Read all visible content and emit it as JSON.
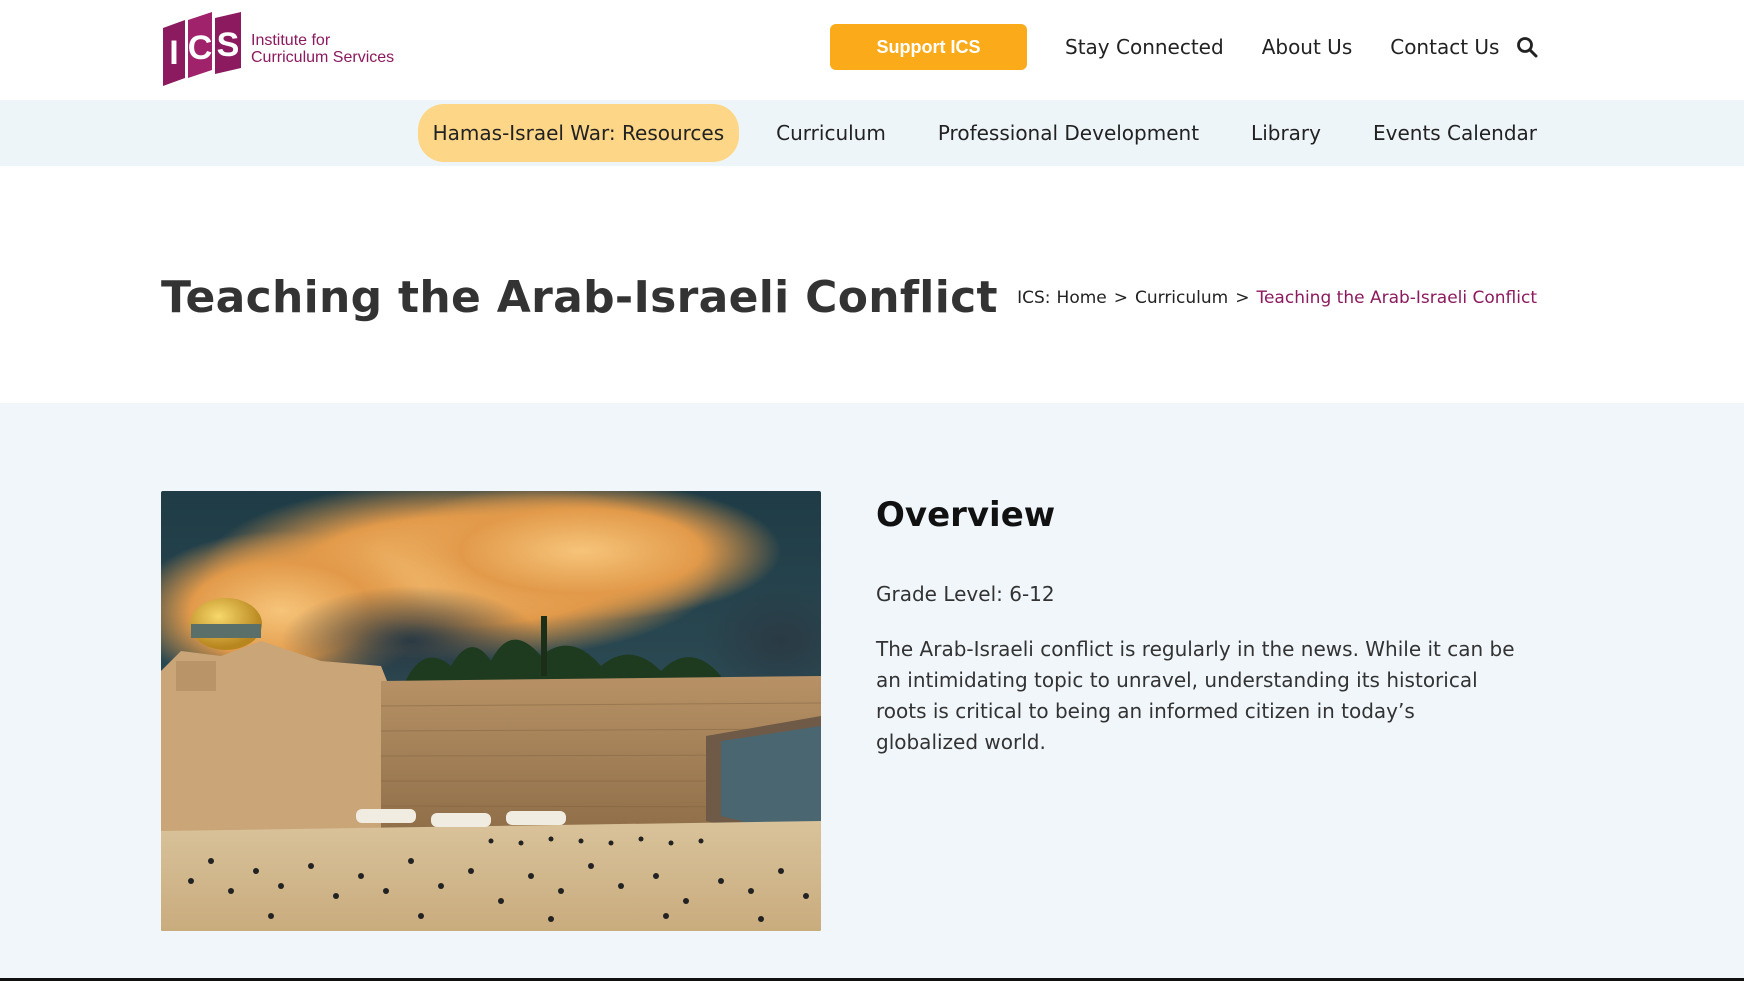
{
  "header": {
    "logo": {
      "mark": "ICS",
      "line1": "Institute for",
      "line2": "Curriculum Services"
    },
    "support_button": "Support ICS",
    "links": [
      "Stay Connected",
      "About Us",
      "Contact Us"
    ],
    "search_icon": "search-icon"
  },
  "nav": {
    "items": [
      {
        "label": "Hamas-Israel War: Resources",
        "active": true
      },
      {
        "label": "Curriculum"
      },
      {
        "label": "Professional Development"
      },
      {
        "label": "Library"
      },
      {
        "label": "Events Calendar"
      }
    ]
  },
  "page": {
    "title": "Teaching the Arab-Israeli Conflict",
    "breadcrumb": {
      "prefix": "ICS:",
      "items": [
        "Home",
        "Curriculum"
      ],
      "separator": ">",
      "current": "Teaching the Arab-Israeli Conflict"
    }
  },
  "overview": {
    "heading": "Overview",
    "grade": "Grade Level: 6-12",
    "description": "The Arab-Israeli conflict is regularly in the news. While it can be an intimidating topic to unravel, understanding its historical roots is critical to being an informed citizen in today’s globalized world."
  },
  "colors": {
    "brand": "#8b1a5e",
    "support": "#fbaa19",
    "active_nav": "#fdd687",
    "nav_bg": "#eef5f9",
    "content_bg": "#f0f6fa"
  }
}
